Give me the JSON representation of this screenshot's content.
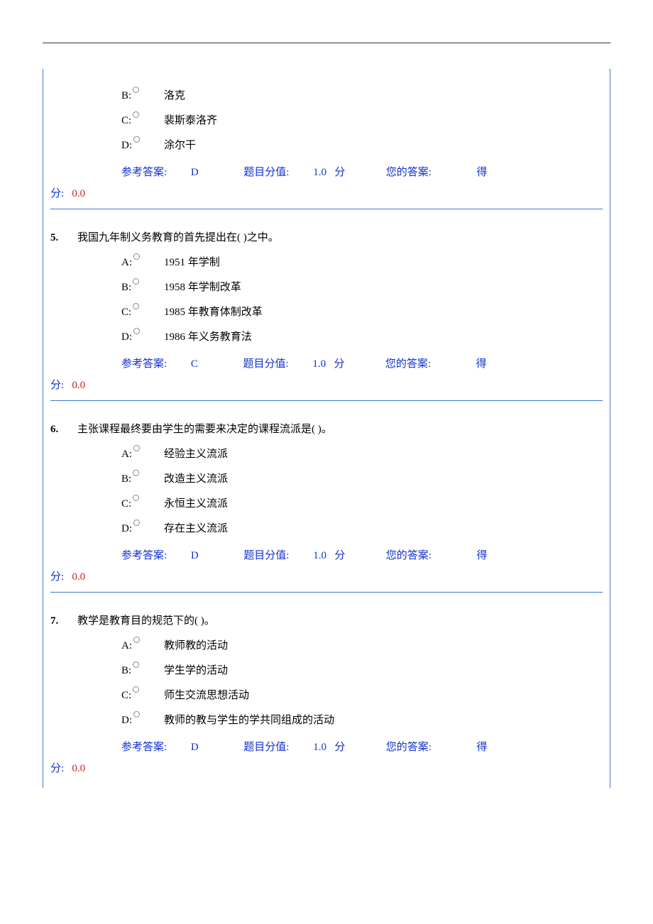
{
  "labels": {
    "ref_ans": "参考答案:",
    "item_score": "题目分值:",
    "score_unit": "分",
    "your_ans": "您的答案:",
    "got_label": "得",
    "got_label2": "分:"
  },
  "q4": {
    "opts": {
      "B": {
        "letter": "B:",
        "text": "洛克"
      },
      "C": {
        "letter": "C:",
        "text": "裴斯泰洛齐"
      },
      "D": {
        "letter": "D:",
        "text": "涂尔干"
      }
    },
    "ans": "D",
    "score": "1.0",
    "got": "0.0"
  },
  "q5": {
    "num": "5.",
    "stem": "我国九年制义务教育的首先提出在( )之中。",
    "opts": {
      "A": {
        "letter": "A:",
        "text": "1951 年学制"
      },
      "B": {
        "letter": "B:",
        "text": "1958 年学制改革"
      },
      "C": {
        "letter": "C:",
        "text": "1985 年教育体制改革"
      },
      "D": {
        "letter": "D:",
        "text": "1986 年义务教育法"
      }
    },
    "ans": "C",
    "score": "1.0",
    "got": "0.0"
  },
  "q6": {
    "num": "6.",
    "stem": "主张课程最终要由学生的需要来决定的课程流派是( )。",
    "opts": {
      "A": {
        "letter": "A:",
        "text": "经验主义流派"
      },
      "B": {
        "letter": "B:",
        "text": "改造主义流派"
      },
      "C": {
        "letter": "C:",
        "text": "永恒主义流派"
      },
      "D": {
        "letter": "D:",
        "text": "存在主义流派"
      }
    },
    "ans": "D",
    "score": "1.0",
    "got": "0.0"
  },
  "q7": {
    "num": "7.",
    "stem": "教学是教育目的规范下的( )。",
    "opts": {
      "A": {
        "letter": "A:",
        "text": "教师教的活动"
      },
      "B": {
        "letter": "B:",
        "text": "学生学的活动"
      },
      "C": {
        "letter": "C:",
        "text": "师生交流思想活动"
      },
      "D": {
        "letter": "D:",
        "text": "教师的教与学生的学共同组成的活动"
      }
    },
    "ans": "D",
    "score": "1.0",
    "got": "0.0"
  }
}
